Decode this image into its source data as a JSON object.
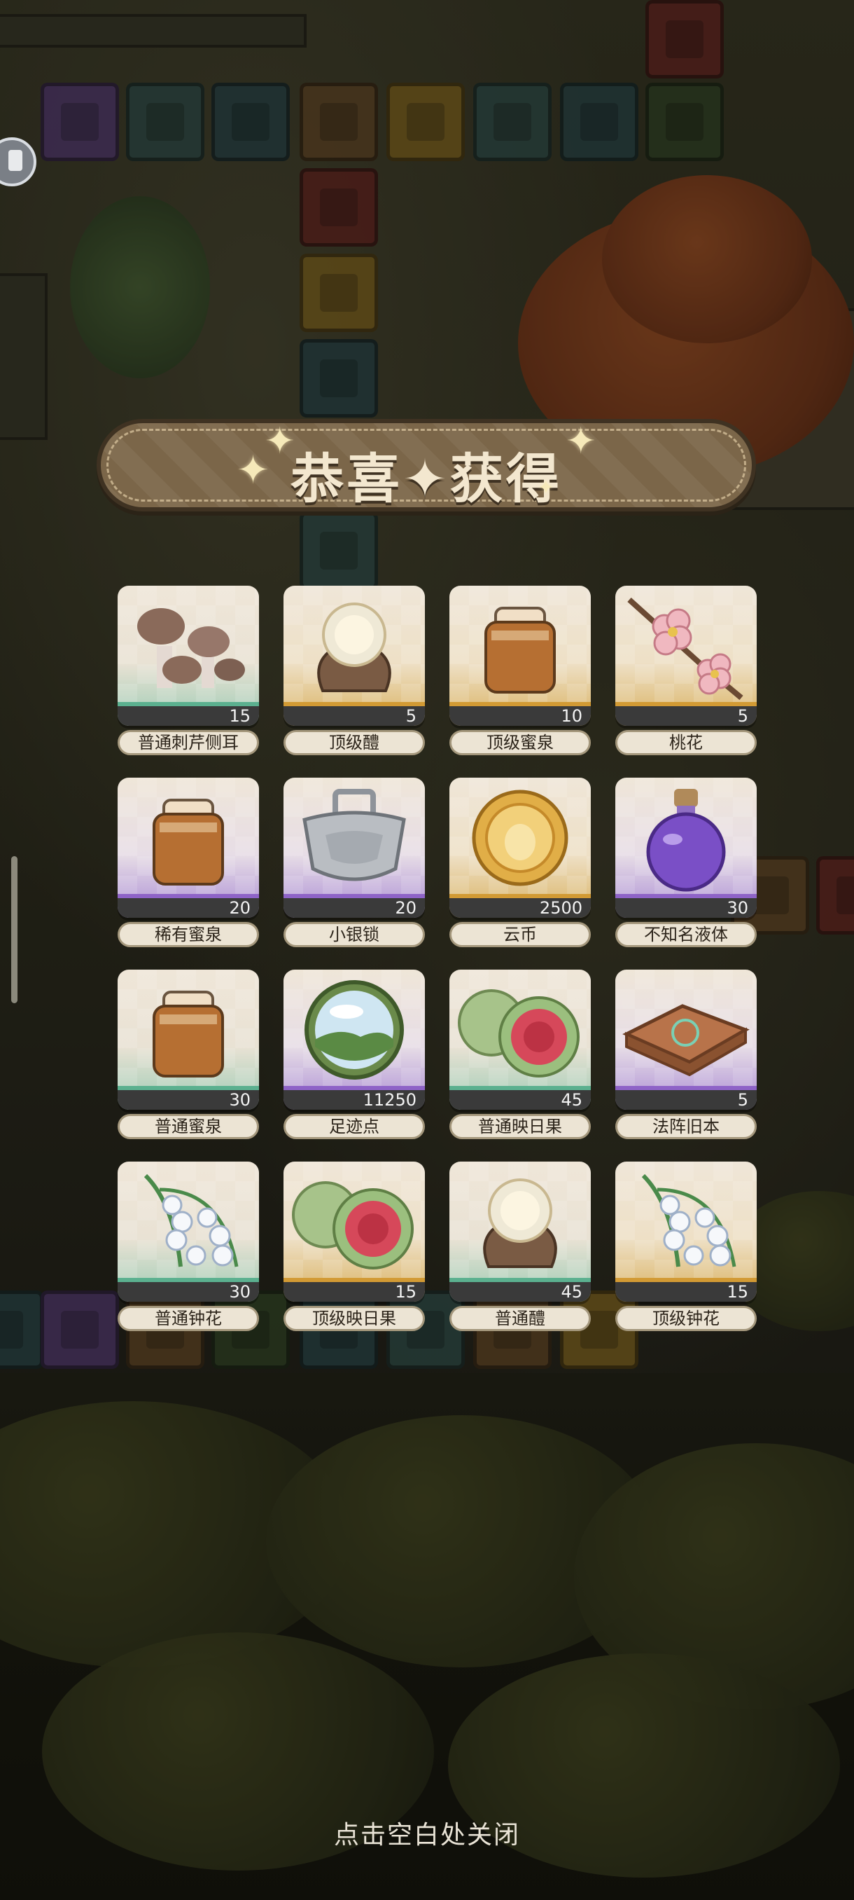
{
  "banner": {
    "title": "恭喜✦获得"
  },
  "rewards": [
    {
      "name": "普通刺芹侧耳",
      "qty": "15",
      "rarity": "green",
      "icon": "mushroom-icon"
    },
    {
      "name": "顶级醴",
      "qty": "5",
      "rarity": "gold",
      "icon": "wine-jar-icon"
    },
    {
      "name": "顶级蜜泉",
      "qty": "10",
      "rarity": "gold",
      "icon": "honey-jar-icon"
    },
    {
      "name": "桃花",
      "qty": "5",
      "rarity": "gold",
      "icon": "peach-blossom-icon"
    },
    {
      "name": "稀有蜜泉",
      "qty": "20",
      "rarity": "purple",
      "icon": "honey-jar-icon"
    },
    {
      "name": "小银锁",
      "qty": "20",
      "rarity": "purple",
      "icon": "silver-lock-icon"
    },
    {
      "name": "云币",
      "qty": "2500",
      "rarity": "gold",
      "icon": "coin-icon"
    },
    {
      "name": "不知名液体",
      "qty": "30",
      "rarity": "purple",
      "icon": "potion-bottle-icon"
    },
    {
      "name": "普通蜜泉",
      "qty": "30",
      "rarity": "green",
      "icon": "honey-jar-icon"
    },
    {
      "name": "足迹点",
      "qty": "11250",
      "rarity": "purple",
      "icon": "landscape-orb-icon"
    },
    {
      "name": "普通映日果",
      "qty": "45",
      "rarity": "green",
      "icon": "fig-icon"
    },
    {
      "name": "法阵旧本",
      "qty": "5",
      "rarity": "purple",
      "icon": "old-book-icon"
    },
    {
      "name": "普通钟花",
      "qty": "30",
      "rarity": "green",
      "icon": "bellflower-icon"
    },
    {
      "name": "顶级映日果",
      "qty": "15",
      "rarity": "gold",
      "icon": "fig-icon"
    },
    {
      "name": "普通醴",
      "qty": "45",
      "rarity": "green",
      "icon": "wine-jar-icon"
    },
    {
      "name": "顶级钟花",
      "qty": "15",
      "rarity": "gold",
      "icon": "bellflower-icon"
    }
  ],
  "footer": {
    "close_hint": "点击空白处关闭"
  },
  "colors": {
    "green": "#5bb08f",
    "gold": "#d29a34",
    "purple": "#8e63c7"
  }
}
